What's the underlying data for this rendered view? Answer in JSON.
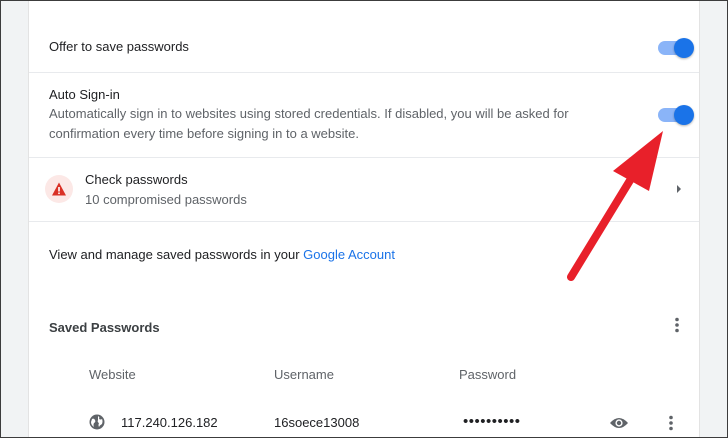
{
  "offer_save": {
    "label": "Offer to save passwords",
    "enabled": true
  },
  "auto_signin": {
    "title": "Auto Sign-in",
    "description_line1": "Automatically sign in to websites using stored credentials. If disabled, you will be asked for",
    "description_line2": "confirmation every time before signing in to a website.",
    "enabled": true
  },
  "check_passwords": {
    "title": "Check passwords",
    "subtitle": "10 compromised passwords"
  },
  "manage": {
    "text": "View and manage saved passwords in your ",
    "link": "Google Account"
  },
  "saved": {
    "title": "Saved Passwords",
    "columns": [
      "Website",
      "Username",
      "Password"
    ],
    "rows": [
      {
        "website": "117.240.126.182",
        "username": "16soece13008",
        "password": "••••••••••"
      }
    ]
  },
  "colors": {
    "accent": "#1a73e8",
    "warning": "#d93025",
    "arrow": "#e8202a"
  },
  "icons": [
    "warning-icon",
    "chevron-right-icon",
    "more-vert-icon",
    "globe-icon",
    "eye-icon"
  ]
}
